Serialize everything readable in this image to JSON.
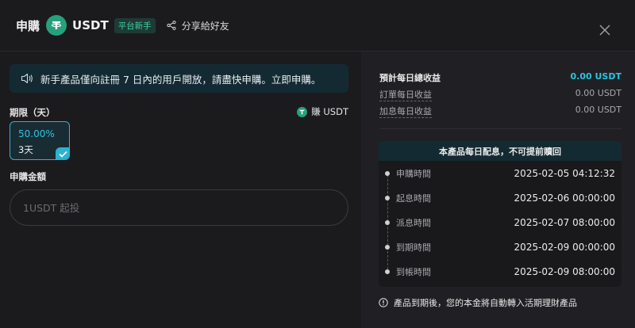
{
  "header": {
    "title": "申購",
    "coin": "USDT",
    "badge": "平台新手",
    "share_label": "分享給好友"
  },
  "colors": {
    "accent": "#2bc4e0",
    "tether_green": "#26a17b",
    "notice_bg": "#142a33"
  },
  "notice": {
    "text": "新手產品僅向註冊 7 日內的用戶開放，請盡快申購。立即申購。"
  },
  "period": {
    "label": "期限（天）",
    "earn_label": "賺 USDT",
    "option": {
      "rate": "50.00%",
      "days": "3天",
      "selected": true
    }
  },
  "amount": {
    "label": "申購金額",
    "placeholder": "1USDT 起投",
    "value": ""
  },
  "summary": {
    "total_label": "預計每日總收益",
    "total_value": "0.00 USDT",
    "order_label": "訂單每日收益",
    "order_value": "0.00 USDT",
    "bonus_label": "加息每日收益",
    "bonus_value": "0.00 USDT"
  },
  "timeline": {
    "heading": "本產品每日配息，不可提前贖回",
    "items": [
      {
        "label": "申購時間",
        "time": "2025-02-05 04:12:32"
      },
      {
        "label": "起息時間",
        "time": "2025-02-06 00:00:00"
      },
      {
        "label": "派息時間",
        "time": "2025-02-07 08:00:00"
      },
      {
        "label": "到期時間",
        "time": "2025-02-09 00:00:00"
      },
      {
        "label": "到帳時間",
        "time": "2025-02-09 08:00:00"
      }
    ]
  },
  "footnote": {
    "text": "產品到期後，您的本金將自動轉入活期理財產品"
  },
  "icons": {
    "coin": "tether-icon",
    "share": "share-icon",
    "close": "close-icon",
    "notice": "speaker-icon",
    "check": "check-icon",
    "info": "info-icon"
  }
}
